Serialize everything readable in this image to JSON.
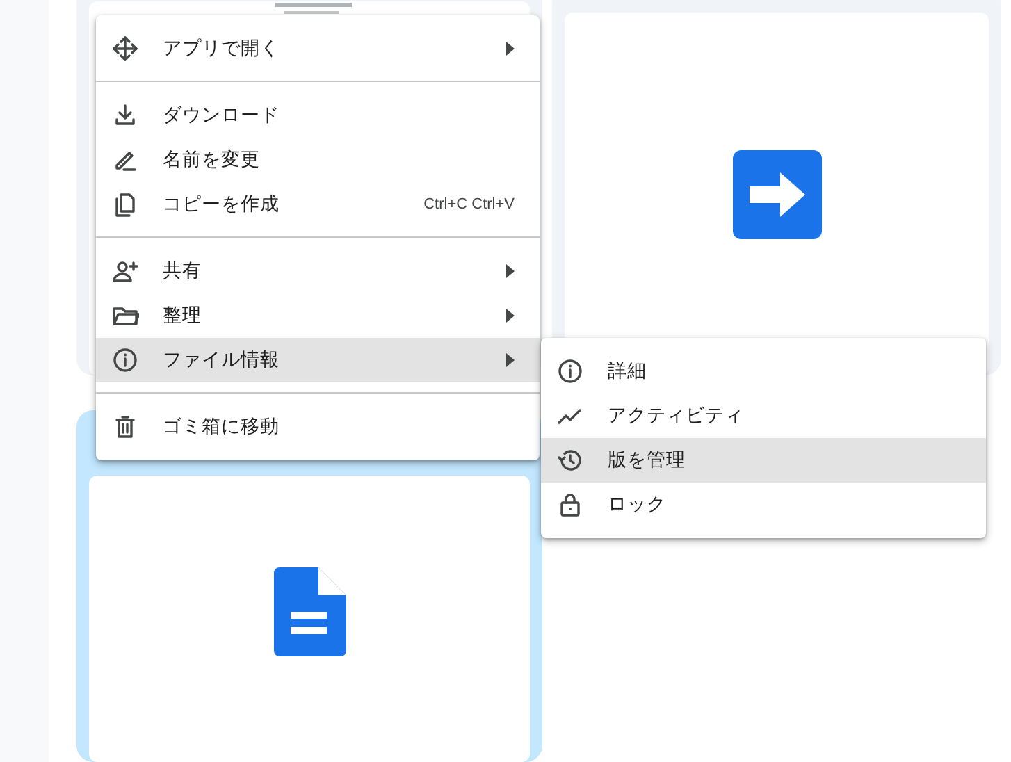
{
  "files": [
    {
      "kind": "thumbnail",
      "selected": false
    },
    {
      "kind": "shortcut",
      "selected": false
    },
    {
      "kind": "document",
      "selected": true
    }
  ],
  "context_menu": {
    "items": [
      {
        "kind": "item",
        "label": "アプリで開く",
        "has_submenu": true,
        "selected": false
      },
      {
        "kind": "separator"
      },
      {
        "kind": "item",
        "label": "ダウンロード",
        "has_submenu": false,
        "selected": false
      },
      {
        "kind": "item",
        "label": "名前を変更",
        "has_submenu": false,
        "selected": false
      },
      {
        "kind": "item",
        "label": "コピーを作成",
        "shortcut": "Ctrl+C Ctrl+V",
        "has_submenu": false,
        "selected": false
      },
      {
        "kind": "separator"
      },
      {
        "kind": "item",
        "label": "共有",
        "has_submenu": true,
        "selected": false
      },
      {
        "kind": "item",
        "label": "整理",
        "has_submenu": true,
        "selected": false
      },
      {
        "kind": "item",
        "label": "ファイル情報",
        "has_submenu": true,
        "selected": true
      },
      {
        "kind": "separator"
      },
      {
        "kind": "item",
        "label": "ゴミ箱に移動",
        "has_submenu": false,
        "selected": false
      }
    ]
  },
  "submenu": {
    "items": [
      {
        "kind": "item",
        "label": "詳細",
        "has_submenu": false,
        "selected": false
      },
      {
        "kind": "item",
        "label": "アクティビティ",
        "has_submenu": false,
        "selected": false
      },
      {
        "kind": "item",
        "label": "版を管理",
        "has_submenu": false,
        "selected": true
      },
      {
        "kind": "item",
        "label": "ロック",
        "has_submenu": false,
        "selected": false
      }
    ]
  }
}
